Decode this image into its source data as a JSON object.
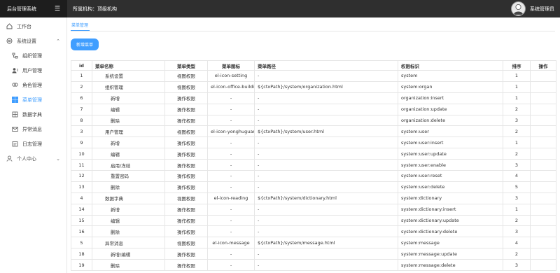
{
  "app": {
    "title": "后台管理系统"
  },
  "header": {
    "org_label": "所属机构：",
    "org_value": "顶级机构",
    "username": "系统管理员"
  },
  "sidebar": {
    "items": [
      {
        "label": "工作台",
        "icon": "home-icon"
      },
      {
        "label": "系统设置",
        "icon": "settings-icon",
        "expanded": true
      }
    ],
    "sub_items": [
      {
        "label": "组织管理",
        "icon": "org-chart-icon"
      },
      {
        "label": "用户管理",
        "icon": "user-icon"
      },
      {
        "label": "角色管理",
        "icon": "role-icon"
      },
      {
        "label": "菜单管理",
        "icon": "menu-grid-icon",
        "active": true
      },
      {
        "label": "数据字典",
        "icon": "dictionary-icon"
      },
      {
        "label": "异常消息",
        "icon": "message-icon"
      },
      {
        "label": "日志管理",
        "icon": "log-icon"
      }
    ],
    "personal": {
      "label": "个人中心",
      "icon": "person-icon"
    }
  },
  "main": {
    "tab": "菜单管理",
    "new_button": "新增菜单",
    "table": {
      "headers": [
        "id",
        "菜单名称",
        "菜单类型",
        "菜单图标",
        "菜单路径",
        "权限标识",
        "排序",
        "操作"
      ],
      "rows": [
        {
          "id": "1",
          "name": "系统设置",
          "type": "视图权限",
          "icon": "el-icon-setting",
          "path": "-",
          "perm": "system",
          "sort": "1",
          "level": 0
        },
        {
          "id": "2",
          "name": "组织管理",
          "type": "视图权限",
          "icon": "el-icon-office-building",
          "path": "${ctxPath}/system/organization.html",
          "perm": "system:organ",
          "sort": "1",
          "level": 0
        },
        {
          "id": "6",
          "name": "新增",
          "type": "操作权限",
          "icon": "-",
          "path": "-",
          "perm": "organization:insert",
          "sort": "1",
          "level": 1
        },
        {
          "id": "7",
          "name": "编辑",
          "type": "操作权限",
          "icon": "-",
          "path": "-",
          "perm": "organization:update",
          "sort": "2",
          "level": 1
        },
        {
          "id": "8",
          "name": "删除",
          "type": "操作权限",
          "icon": "-",
          "path": "-",
          "perm": "organization:delete",
          "sort": "3",
          "level": 1
        },
        {
          "id": "3",
          "name": "用户管理",
          "type": "视图权限",
          "icon": "el-icon-yonghuguanli",
          "path": "${ctxPath}/system/user.html",
          "perm": "system:user",
          "sort": "2",
          "level": 0
        },
        {
          "id": "9",
          "name": "新增",
          "type": "操作权限",
          "icon": "-",
          "path": "-",
          "perm": "system:user:insert",
          "sort": "1",
          "level": 1
        },
        {
          "id": "10",
          "name": "编辑",
          "type": "操作权限",
          "icon": "-",
          "path": "-",
          "perm": "system:user:update",
          "sort": "2",
          "level": 1
        },
        {
          "id": "11",
          "name": "启用/冻结",
          "type": "操作权限",
          "icon": "-",
          "path": "-",
          "perm": "system:user:enable",
          "sort": "3",
          "level": 1
        },
        {
          "id": "12",
          "name": "重置密码",
          "type": "操作权限",
          "icon": "-",
          "path": "-",
          "perm": "system:user:reset",
          "sort": "4",
          "level": 1
        },
        {
          "id": "13",
          "name": "删除",
          "type": "操作权限",
          "icon": "-",
          "path": "-",
          "perm": "system:user:delete",
          "sort": "5",
          "level": 1
        },
        {
          "id": "4",
          "name": "数据字典",
          "type": "视图权限",
          "icon": "el-icon-reading",
          "path": "${ctxPath}/system/dictionary.html",
          "perm": "system:dictionary",
          "sort": "3",
          "level": 0
        },
        {
          "id": "14",
          "name": "新增",
          "type": "操作权限",
          "icon": "-",
          "path": "-",
          "perm": "system:dictionary:insert",
          "sort": "1",
          "level": 1
        },
        {
          "id": "15",
          "name": "编辑",
          "type": "操作权限",
          "icon": "-",
          "path": "-",
          "perm": "system:dictionary:update",
          "sort": "2",
          "level": 1
        },
        {
          "id": "16",
          "name": "删除",
          "type": "操作权限",
          "icon": "-",
          "path": "-",
          "perm": "system:dictionary:delete",
          "sort": "3",
          "level": 1
        },
        {
          "id": "5",
          "name": "异常消息",
          "type": "视图权限",
          "icon": "el-icon-message",
          "path": "${ctxPath}/system/message.html",
          "perm": "system:message",
          "sort": "4",
          "level": 0
        },
        {
          "id": "18",
          "name": "新增/编辑",
          "type": "操作权限",
          "icon": "-",
          "path": "-",
          "perm": "system:message:update",
          "sort": "2",
          "level": 1
        },
        {
          "id": "19",
          "name": "删除",
          "type": "操作权限",
          "icon": "-",
          "path": "-",
          "perm": "system:message:delete",
          "sort": "3",
          "level": 1
        }
      ]
    }
  },
  "colors": {
    "accent": "#409eff",
    "header_bg": "#2f2f2f",
    "logo_bg": "#1d1d1d"
  }
}
